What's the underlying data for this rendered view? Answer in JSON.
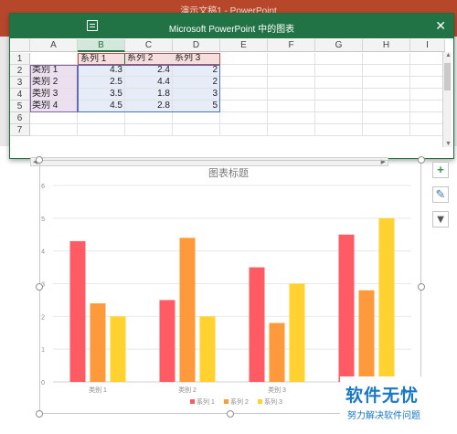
{
  "app": {
    "window_title": "演示文稿1 - PowerPoint"
  },
  "excel": {
    "window_title": "Microsoft PowerPoint 中的图表",
    "close_icon": "close-icon",
    "columns": [
      "A",
      "B",
      "C",
      "D",
      "E",
      "F",
      "G",
      "H",
      "I"
    ],
    "rows": [
      "1",
      "2",
      "3",
      "4",
      "5",
      "6",
      "7"
    ],
    "cells": [
      [
        "",
        "系列 1",
        "系列 2",
        "系列 3"
      ],
      [
        "类别 1",
        "4.3",
        "2.4",
        "2"
      ],
      [
        "类别 2",
        "2.5",
        "4.4",
        "2"
      ],
      [
        "类别 3",
        "3.5",
        "1.8",
        "3"
      ],
      [
        "类别 4",
        "4.5",
        "2.8",
        "5"
      ]
    ],
    "selected_column": "B"
  },
  "chart": {
    "title": "图表标题",
    "side_buttons": [
      "plus-icon",
      "brush-icon",
      "filter-icon"
    ]
  },
  "chart_data": {
    "type": "bar",
    "title": "图表标题",
    "categories": [
      "类别 1",
      "类别 2",
      "类别 3",
      "类别 4"
    ],
    "series": [
      {
        "name": "系列 1",
        "values": [
          4.3,
          2.5,
          3.5,
          4.5
        ],
        "color": "#ff5b64"
      },
      {
        "name": "系列 2",
        "values": [
          2.4,
          4.4,
          1.8,
          2.8
        ],
        "color": "#ff9a3c"
      },
      {
        "name": "系列 3",
        "values": [
          2,
          2,
          3,
          5
        ],
        "color": "#ffd230"
      }
    ],
    "yticks": [
      "0",
      "1",
      "2",
      "3",
      "4",
      "5",
      "6"
    ],
    "ylim": [
      0,
      6
    ],
    "grid": true,
    "legend": "bottom"
  },
  "watermark": {
    "main": "软件无忧",
    "sub": "努力解决软件问题"
  }
}
